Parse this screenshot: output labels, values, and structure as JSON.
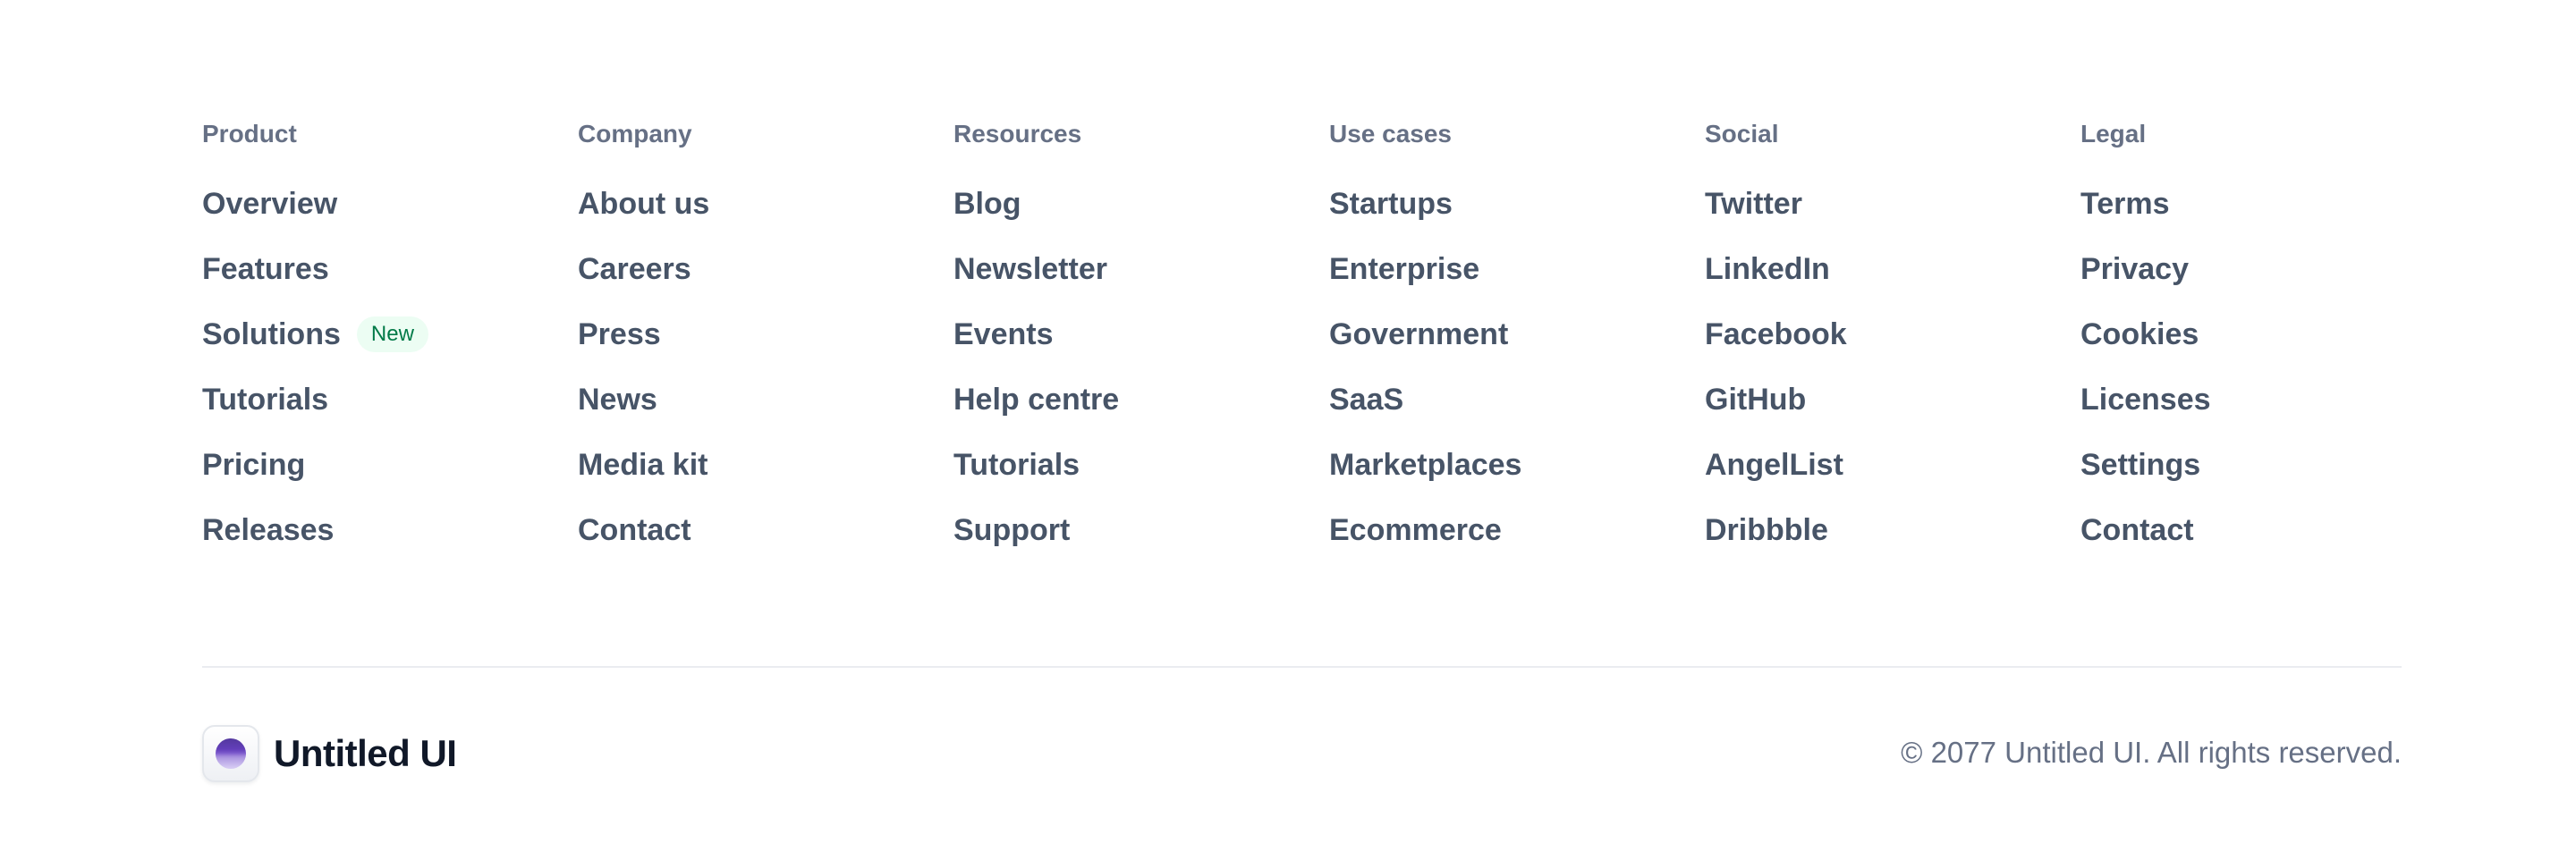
{
  "columns": [
    {
      "heading": "Product",
      "links": [
        {
          "label": "Overview"
        },
        {
          "label": "Features"
        },
        {
          "label": "Solutions",
          "badge": "New"
        },
        {
          "label": "Tutorials"
        },
        {
          "label": "Pricing"
        },
        {
          "label": "Releases"
        }
      ]
    },
    {
      "heading": "Company",
      "links": [
        {
          "label": "About us"
        },
        {
          "label": "Careers"
        },
        {
          "label": "Press"
        },
        {
          "label": "News"
        },
        {
          "label": "Media kit"
        },
        {
          "label": "Contact"
        }
      ]
    },
    {
      "heading": "Resources",
      "links": [
        {
          "label": "Blog"
        },
        {
          "label": "Newsletter"
        },
        {
          "label": "Events"
        },
        {
          "label": "Help centre"
        },
        {
          "label": "Tutorials"
        },
        {
          "label": "Support"
        }
      ]
    },
    {
      "heading": "Use cases",
      "links": [
        {
          "label": "Startups"
        },
        {
          "label": "Enterprise"
        },
        {
          "label": "Government"
        },
        {
          "label": "SaaS"
        },
        {
          "label": "Marketplaces"
        },
        {
          "label": "Ecommerce"
        }
      ]
    },
    {
      "heading": "Social",
      "links": [
        {
          "label": "Twitter"
        },
        {
          "label": "LinkedIn"
        },
        {
          "label": "Facebook"
        },
        {
          "label": "GitHub"
        },
        {
          "label": "AngelList"
        },
        {
          "label": "Dribbble"
        }
      ]
    },
    {
      "heading": "Legal",
      "links": [
        {
          "label": "Terms"
        },
        {
          "label": "Privacy"
        },
        {
          "label": "Cookies"
        },
        {
          "label": "Licenses"
        },
        {
          "label": "Settings"
        },
        {
          "label": "Contact"
        }
      ]
    }
  ],
  "brand": {
    "name": "Untitled UI",
    "logo_icon": "purple-orb-logo-icon"
  },
  "copyright": "© 2077 Untitled UI. All rights reserved.",
  "colors": {
    "heading": "#667085",
    "link": "#475467",
    "badge_bg": "#ECFDF3",
    "badge_text": "#027A48",
    "brand_text": "#101828",
    "divider": "#EAECF0",
    "accent": "#6941C6"
  }
}
